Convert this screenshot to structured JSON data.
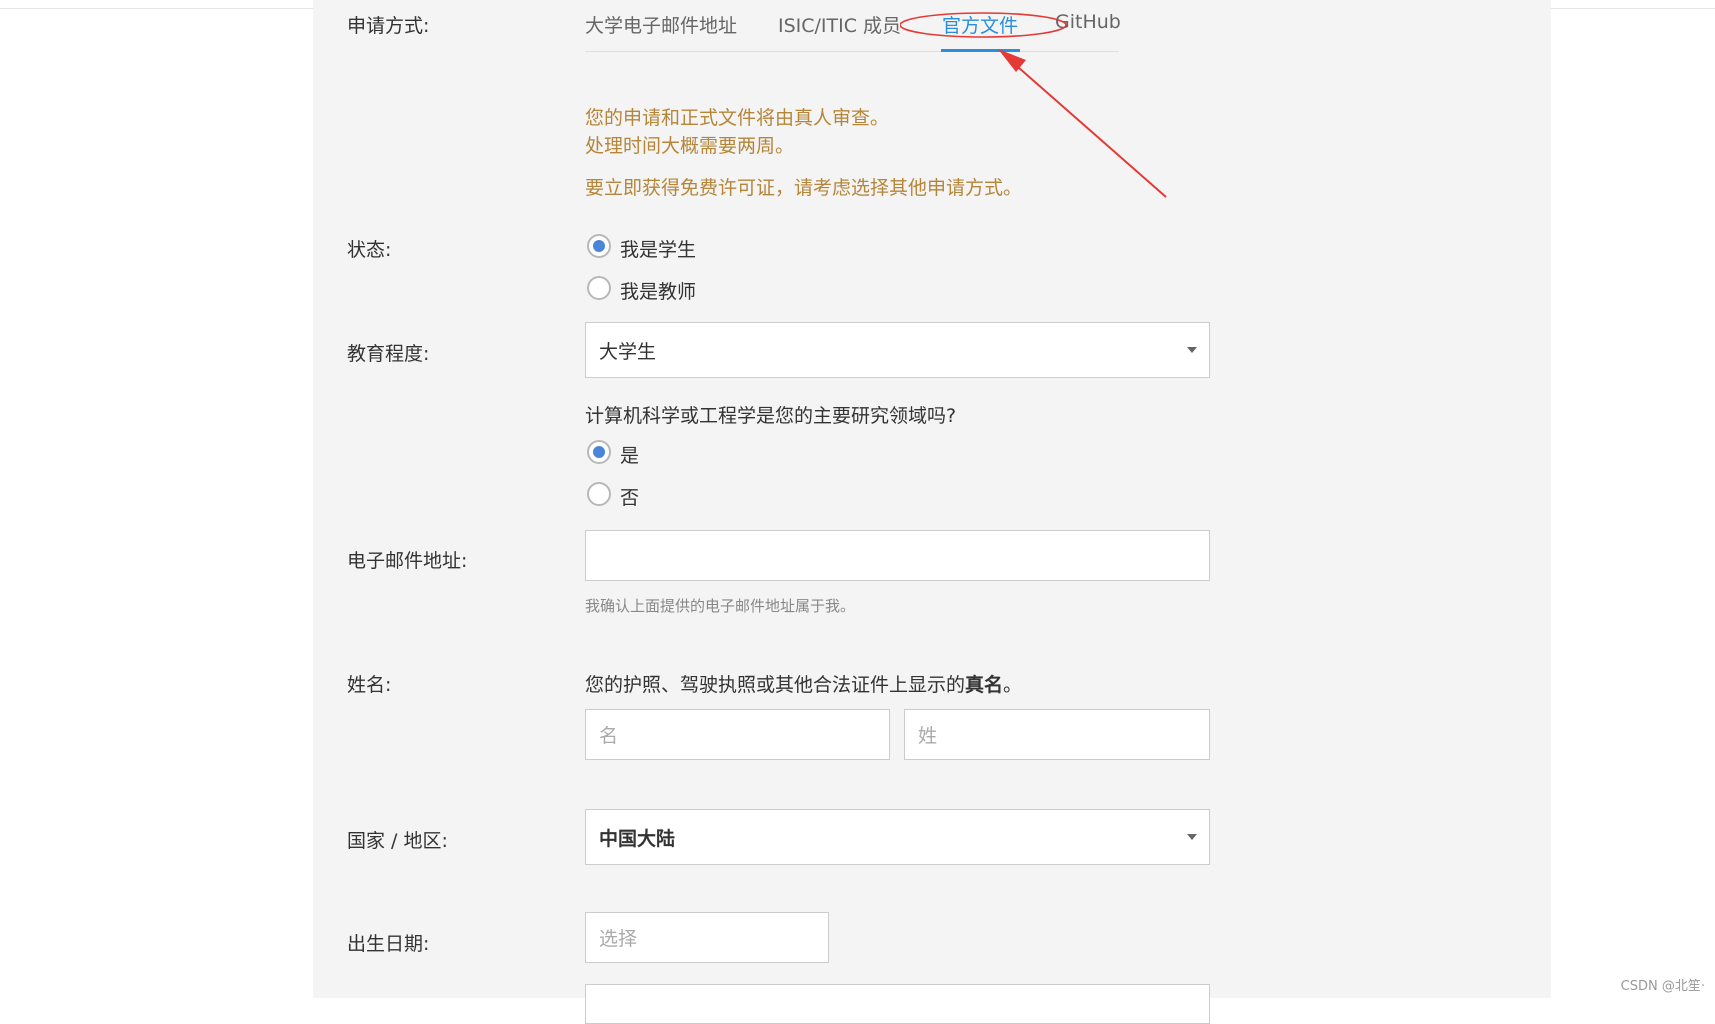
{
  "application_method": {
    "label": "申请方式:",
    "tabs": [
      {
        "label": "大学电子邮件地址",
        "active": false
      },
      {
        "label": "ISIC/ITIC 成员",
        "active": false
      },
      {
        "label": "官方文件",
        "active": true
      },
      {
        "label": "GitHub",
        "active": false
      }
    ]
  },
  "notice": {
    "line1": "您的申请和正式文件将由真人审查。",
    "line2": "处理时间大概需要两周。",
    "line3": "要立即获得免费许可证，请考虑选择其他申请方式。"
  },
  "status": {
    "label": "状态:",
    "options": [
      {
        "label": "我是学生",
        "selected": true
      },
      {
        "label": "我是教师",
        "selected": false
      }
    ]
  },
  "education": {
    "label": "教育程度:",
    "value": "大学生"
  },
  "field_question": {
    "question": "计算机科学或工程学是您的主要研究领域吗?",
    "options": [
      {
        "label": "是",
        "selected": true
      },
      {
        "label": "否",
        "selected": false
      }
    ]
  },
  "email": {
    "label": "电子邮件地址:",
    "value": "",
    "hint": "我确认上面提供的电子邮件地址属于我。"
  },
  "name": {
    "label": "姓名:",
    "note_prefix": "您的护照、驾驶执照或其他合法证件上显示的",
    "note_bold": "真名",
    "note_suffix": "。",
    "first_placeholder": "名",
    "last_placeholder": "姓"
  },
  "country": {
    "label": "国家 / 地区:",
    "value": "中国大陆"
  },
  "birthdate": {
    "label": "出生日期:",
    "placeholder": "选择"
  },
  "watermark": "CSDN @北笙·",
  "colors": {
    "accent": "#2a8ee0",
    "warning_text": "#b5863a",
    "annotation_red": "#e53935",
    "panel_bg": "#f4f4f4"
  }
}
